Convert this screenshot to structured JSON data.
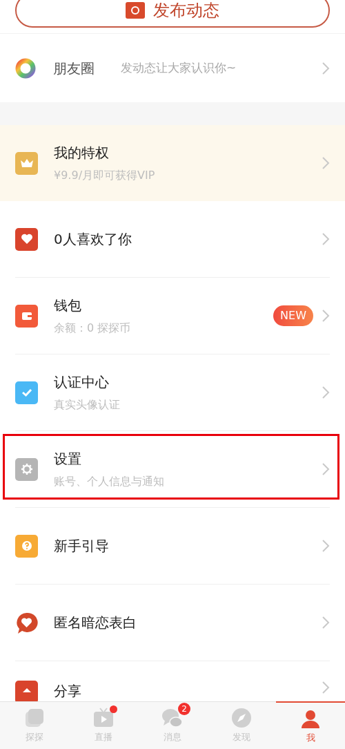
{
  "post_button": {
    "label": "发布动态"
  },
  "moments": {
    "title": "朋友圈",
    "hint": "发动态让大家认识你~"
  },
  "vip": {
    "title": "我的特权",
    "subtitle": "¥9.9/月即可获得VIP"
  },
  "menu": [
    {
      "kind": "heart",
      "title": "0人喜欢了你",
      "highlighted": false
    },
    {
      "kind": "wallet",
      "title": "钱包",
      "subtitle": "余额：0 探探币",
      "badge": "NEW",
      "highlighted": false
    },
    {
      "kind": "verify",
      "title": "认证中心",
      "subtitle": "真实头像认证",
      "highlighted": false
    },
    {
      "kind": "settings",
      "title": "设置",
      "subtitle": "账号、个人信息与通知",
      "highlighted": true
    },
    {
      "kind": "guide",
      "title": "新手引导",
      "highlighted": false
    },
    {
      "kind": "confess",
      "title": "匿名暗恋表白",
      "highlighted": false
    },
    {
      "kind": "share",
      "title": "分享",
      "highlighted": false
    }
  ],
  "tabs": [
    {
      "kind": "cards",
      "label": "探探",
      "selected": false
    },
    {
      "kind": "live",
      "label": "直播",
      "selected": false,
      "dot": true
    },
    {
      "kind": "chat",
      "label": "消息",
      "selected": false,
      "count": "2"
    },
    {
      "kind": "compass",
      "label": "发现",
      "selected": false
    },
    {
      "kind": "me",
      "label": "我",
      "selected": true
    }
  ]
}
